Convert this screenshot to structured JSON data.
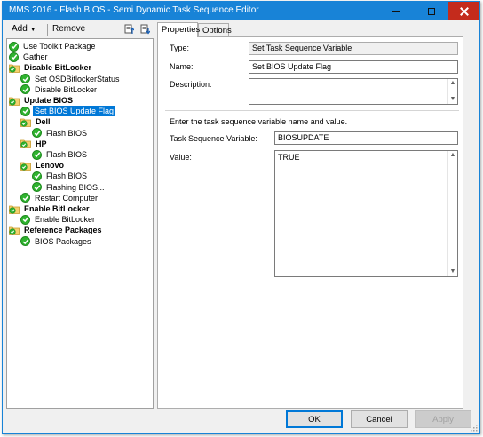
{
  "window": {
    "title": "MMS 2016 - Flash BIOS - Semi Dynamic Task Sequence Editor",
    "accent_color": "#1883d7"
  },
  "toolbar": {
    "add_label": "Add",
    "remove_label": "Remove",
    "move_up_icon": "move-up-icon",
    "move_down_icon": "move-down-icon"
  },
  "tree": {
    "items": [
      {
        "label": "Use Toolkit Package",
        "type": "step",
        "level": 0
      },
      {
        "label": "Gather",
        "type": "step",
        "level": 0
      },
      {
        "label": "Disable BitLocker",
        "type": "group",
        "level": 0
      },
      {
        "label": "Set OSDBitlockerStatus",
        "type": "step",
        "level": 1
      },
      {
        "label": "Disable BitLocker",
        "type": "step",
        "level": 1
      },
      {
        "label": "Update BIOS",
        "type": "group",
        "level": 0
      },
      {
        "label": "Set BIOS Update Flag",
        "type": "step",
        "level": 1,
        "selected": true
      },
      {
        "label": "Dell",
        "type": "group",
        "level": 1
      },
      {
        "label": "Flash BIOS",
        "type": "step",
        "level": 2
      },
      {
        "label": "HP",
        "type": "group",
        "level": 1
      },
      {
        "label": "Flash BIOS",
        "type": "step",
        "level": 2
      },
      {
        "label": "Lenovo",
        "type": "group",
        "level": 1
      },
      {
        "label": "Flash BIOS",
        "type": "step",
        "level": 2
      },
      {
        "label": "Flashing BIOS...",
        "type": "step",
        "level": 2
      },
      {
        "label": "Restart Computer",
        "type": "step",
        "level": 1
      },
      {
        "label": "Enable BitLocker",
        "type": "group",
        "level": 0
      },
      {
        "label": "Enable BitLocker",
        "type": "step",
        "level": 1
      },
      {
        "label": "Reference Packages",
        "type": "group",
        "level": 0
      },
      {
        "label": "BIOS Packages",
        "type": "step",
        "level": 1
      }
    ]
  },
  "tabs": {
    "properties": "Properties",
    "options": "Options",
    "active": "Properties"
  },
  "properties": {
    "type_label": "Type:",
    "type_value": "Set Task Sequence Variable",
    "name_label": "Name:",
    "name_value": "Set BIOS Update Flag",
    "description_label": "Description:",
    "description_value": "",
    "instructions": "Enter the task sequence variable name and value.",
    "variable_label": "Task Sequence Variable:",
    "variable_value": "BIOSUPDATE",
    "value_label": "Value:",
    "value_value": "TRUE"
  },
  "buttons": {
    "ok": "OK",
    "cancel": "Cancel",
    "apply": "Apply"
  }
}
